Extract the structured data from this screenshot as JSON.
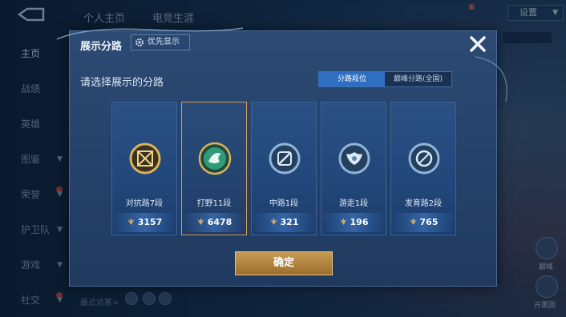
{
  "background": {
    "top_tabs": [
      "个人主页",
      "电竞生涯"
    ],
    "side_nav": [
      {
        "label": "主页",
        "active": true,
        "arrow": false,
        "dot": false
      },
      {
        "label": "战绩",
        "active": false,
        "arrow": false,
        "dot": false
      },
      {
        "label": "英雄",
        "active": false,
        "arrow": false,
        "dot": false
      },
      {
        "label": "图鉴",
        "active": false,
        "arrow": true,
        "dot": false
      },
      {
        "label": "荣誉",
        "active": false,
        "arrow": true,
        "dot": true
      },
      {
        "label": "护卫队",
        "active": false,
        "arrow": true,
        "dot": false
      },
      {
        "label": "游戏",
        "active": false,
        "arrow": true,
        "dot": false
      },
      {
        "label": "社交",
        "active": false,
        "arrow": true,
        "dot": true
      }
    ],
    "settings_label": "设置",
    "bottom_hint": "最近访客>",
    "right_labels": [
      "巅峰",
      "开黑团"
    ]
  },
  "modal": {
    "title": "展示分路",
    "priority_label": "优先显示",
    "prompt": "请选择展示的分路",
    "toggle": {
      "active_label": "分路段位",
      "other_label": "巅峰分路(全国)"
    },
    "confirm_label": "确定",
    "cards": [
      {
        "rank": "对抗路7段",
        "points": "3157",
        "selected": false,
        "emblem": "sword-shield-icon",
        "emblem_color": "#d9b25a"
      },
      {
        "rank": "打野11段",
        "points": "6478",
        "selected": true,
        "emblem": "dragon-icon",
        "emblem_color": "#3fb28a"
      },
      {
        "rank": "中路1段",
        "points": "321",
        "selected": false,
        "emblem": "staff-icon",
        "emblem_color": "#8fb6d9"
      },
      {
        "rank": "游走1段",
        "points": "196",
        "selected": false,
        "emblem": "wings-icon",
        "emblem_color": "#8fb6d9"
      },
      {
        "rank": "发育路2段",
        "points": "765",
        "selected": false,
        "emblem": "bow-icon",
        "emblem_color": "#8fb6d9"
      }
    ]
  },
  "colors": {
    "accent_gold": "#d79a5a",
    "toggle_active": "#2e6fc1",
    "confirm_gold": "#b3843f"
  }
}
